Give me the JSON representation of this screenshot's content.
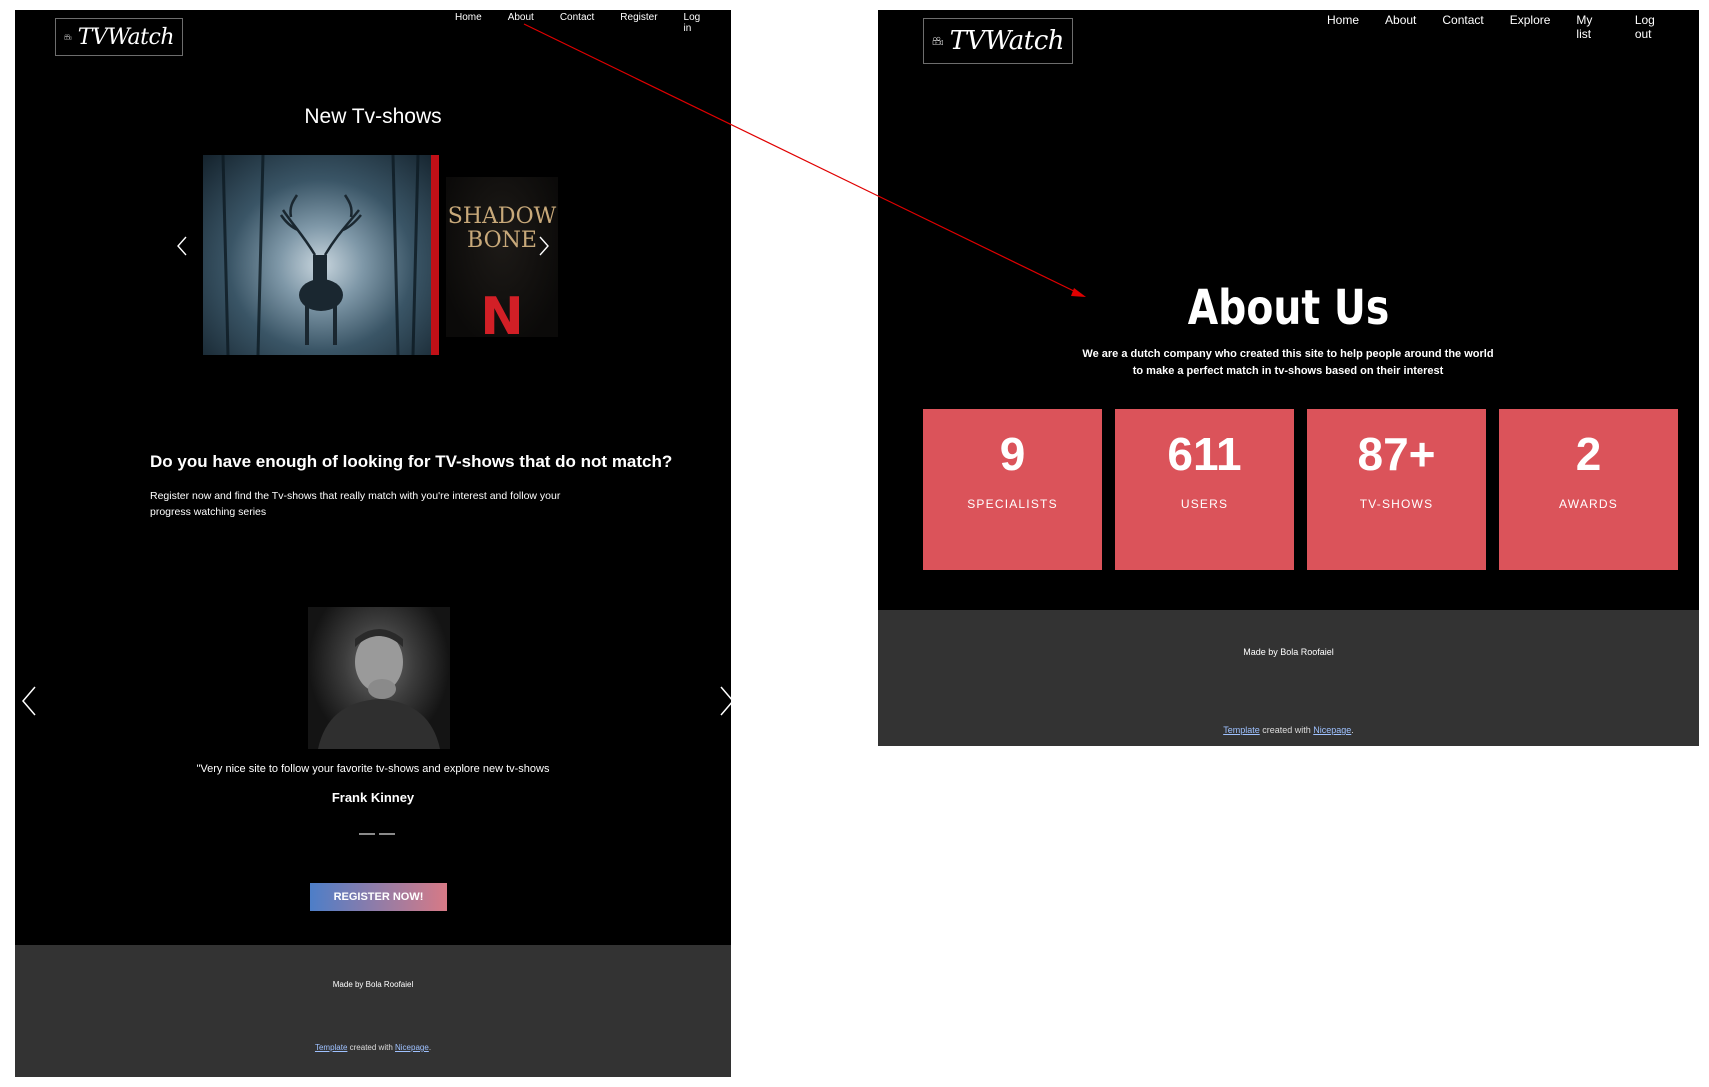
{
  "left_page": {
    "logo_text": "TVWatch",
    "nav": [
      "Home",
      "About",
      "Contact",
      "Register",
      "Log in"
    ],
    "carousel_title": "New Tv-shows",
    "poster_text": [
      "SHADOW",
      "BONE"
    ],
    "poster_logo": "N",
    "question": "Do you have enough of looking for TV-shows that do not match?",
    "description": "Register now and find the Tv-shows that really match with you're interest and follow your progress watching series",
    "testimonial_quote": "\"Very nice site to follow your favorite tv-shows and explore new tv-shows",
    "testimonial_author": "Frank Kinney",
    "register_button": "REGISTER NOW!",
    "footer_made_by": "Made by Bola Roofaiel",
    "footer_template_link": "Template",
    "footer_created_with": " created with ",
    "footer_nicepage_link": "Nicepage",
    "footer_period": "."
  },
  "right_page": {
    "logo_text": "TVWatch",
    "nav": [
      "Home",
      "About",
      "Contact",
      "Explore",
      "My list",
      "Log out"
    ],
    "title": "About Us",
    "description": "We are a dutch company who created this site to help people around the world to make a perfect match in tv-shows based on their interest",
    "stats": [
      {
        "value": "9",
        "label": "SPECIALISTS"
      },
      {
        "value": "611",
        "label": "USERS"
      },
      {
        "value": "87+",
        "label": "TV-SHOWS"
      },
      {
        "value": "2",
        "label": "AWARDS"
      }
    ],
    "footer_made_by": "Made by Bola Roofaiel",
    "footer_template_link": "Template",
    "footer_created_with": " created with ",
    "footer_nicepage_link": "Nicepage",
    "footer_period": "."
  },
  "colors": {
    "page_bg": "#000000",
    "footer_bg": "#333333",
    "stat_tile": "#db535a",
    "annotation_arrow": "#e00000",
    "button_gradient_start": "#4d7ec8",
    "button_gradient_end": "#d77a86"
  },
  "icons": {
    "logo": "camera-icon",
    "carousel_prev": "chevron-left-icon",
    "carousel_next": "chevron-right-icon"
  }
}
